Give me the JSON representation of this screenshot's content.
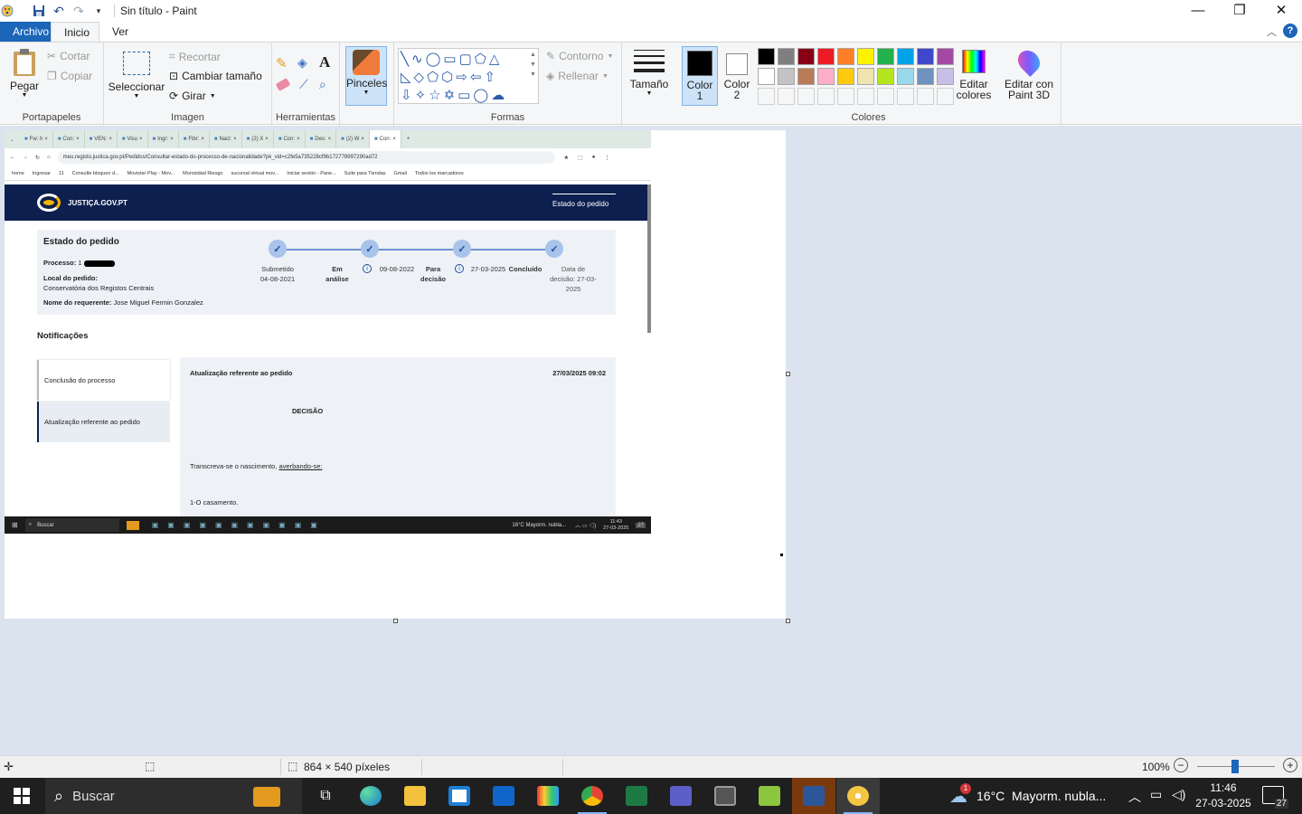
{
  "window": {
    "title": "Sin título - Paint",
    "controls": {
      "minimize": "—",
      "maximize": "❐",
      "close": "✕"
    }
  },
  "ribbon_tabs": [
    "Archivo",
    "Inicio",
    "Ver"
  ],
  "clipboard": {
    "paste": "Pegar",
    "cut": "Cortar",
    "copy": "Copiar",
    "label": "Portapapeles"
  },
  "image": {
    "select": "Seleccionar",
    "crop": "Recortar",
    "resize": "Cambiar tamaño",
    "rotate": "Girar",
    "label": "Imagen"
  },
  "tools": {
    "label": "Herramientas"
  },
  "brushes": {
    "label": "Pinceles"
  },
  "shapes": {
    "outline": "Contorno",
    "fill": "Rellenar",
    "label": "Formas"
  },
  "size": {
    "label": "Tamaño"
  },
  "colors": {
    "color1": "Color\n1",
    "color1_a": "Color",
    "color1_b": "1",
    "color2_a": "Color",
    "color2_b": "2",
    "edit_colors_a": "Editar",
    "edit_colors_b": "colores",
    "paint3d_a": "Editar con",
    "paint3d_b": "Paint 3D",
    "label": "Colores",
    "row1": [
      "#000000",
      "#7f7f7f",
      "#880015",
      "#ed1c24",
      "#ff7f27",
      "#fff200",
      "#22b14c",
      "#00a2e8",
      "#3f48cc",
      "#a349a4"
    ],
    "row2": [
      "#ffffff",
      "#c3c3c3",
      "#b97a57",
      "#ffaec9",
      "#ffc90e",
      "#efe4b0",
      "#b5e61d",
      "#99d9ea",
      "#7092be",
      "#c8bfe7"
    ]
  },
  "screenshot": {
    "chrome_tabs": [
      "Fw: h",
      "Con:",
      "VEN:",
      "Visu",
      "Ingr:",
      "Fibr:",
      "Nacl:",
      "(2) X",
      "Con:",
      "Des:",
      "(2) W",
      "Con:"
    ],
    "url": "meu.registo.justica.gov.pt/Pedidos/Consultar-estado-do-processo-de-nacionalidade?pk_vid=c2fe5a735228cf9b172778997290ad72",
    "bookmarks": [
      "home",
      "Ingresar",
      "11",
      "Consulte bloqueo d...",
      "Movistar Play - Mov...",
      "Morosidad Riesgo",
      "sucursal virtual mov...",
      "Iniciar sesión - Pane...",
      "Suite para Tiendas",
      "Gmail",
      "Todos los marcadores"
    ],
    "site_name": "JUSTIÇA.GOV.PT",
    "header_link": "Estado do pedido",
    "panel_title": "Estado do pedido",
    "processo_label": "Processo:",
    "processo_value": "1",
    "local_label": "Local do pedido:",
    "local_value": "Conservatória dos Registos Centrais",
    "requerente_label": "Nome do requerente:",
    "requerente_value": "Jose Miguel Fermin Gonzalez",
    "steps": [
      {
        "label": "Submetido",
        "date": "04-08-2021"
      },
      {
        "label": "Em",
        "label2": "análise"
      },
      {
        "label": "09-08-2022"
      },
      {
        "label": "Para",
        "label2": "decisão"
      },
      {
        "label": "27-03-2025"
      },
      {
        "label": "Concluído"
      },
      {
        "label": "Data de",
        "label2": "decisão: 27-03-",
        "label3": "2025"
      }
    ],
    "notifications_title": "Notificações",
    "notif_items": [
      "Conclusão do processo",
      "Atualização referente ao pedido"
    ],
    "notif_detail_title": "Atualização referente ao pedido",
    "notif_detail_date": "27/03/2025 09:02",
    "decision_heading": "DECISÃO",
    "body_line1": "Transcreva-se o nascimento,",
    "body_line1_link": "averbando-se:",
    "body_line2": "1-O casamento.",
    "taskbar_search": "Buscar",
    "weather": "16°C  Mayorm. nubla...",
    "time": "11:43",
    "date": "27-03-2025",
    "notif_count": "27"
  },
  "statusbar": {
    "dimensions": "864 × 540 píxeles",
    "zoom": "100%"
  },
  "taskbar": {
    "search": "Buscar",
    "weather": "16°C  Mayorm. nubla...",
    "weather_badge": "1",
    "time": "11:46",
    "date": "27-03-2025",
    "notif_count": "27"
  }
}
